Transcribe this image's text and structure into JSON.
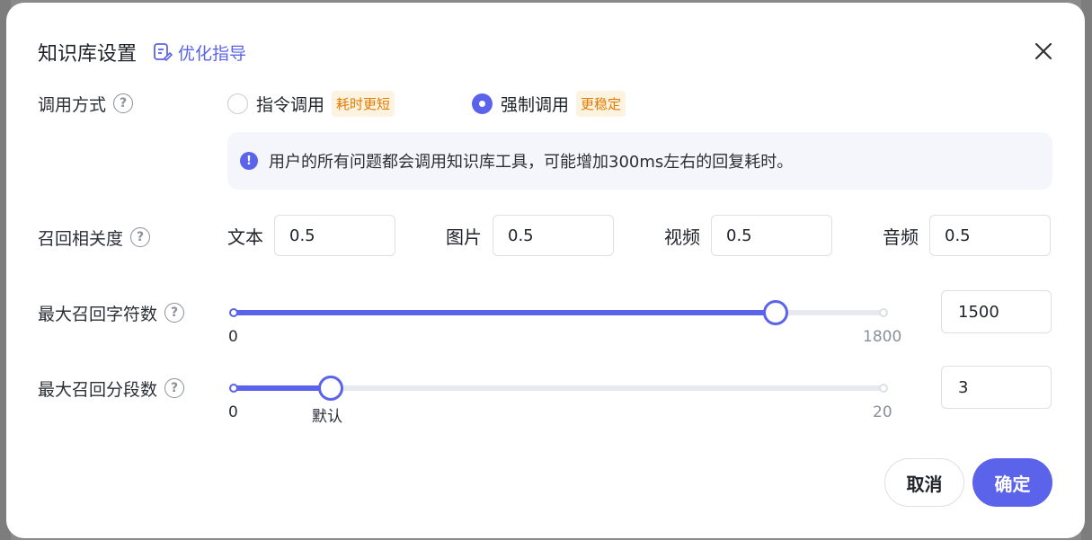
{
  "dialog": {
    "title": "知识库设置",
    "guide_link": "优化指导",
    "close_icon": "close-icon"
  },
  "invoke": {
    "label": "调用方式",
    "options": [
      {
        "label": "指令调用",
        "tag": "耗时更短",
        "checked": false
      },
      {
        "label": "强制调用",
        "tag": "更稳定",
        "checked": true
      }
    ],
    "info": "用户的所有问题都会调用知识库工具，可能增加300ms左右的回复耗时。"
  },
  "relevance": {
    "label": "召回相关度",
    "items": [
      {
        "label": "文本",
        "value": "0.5"
      },
      {
        "label": "图片",
        "value": "0.5"
      },
      {
        "label": "视频",
        "value": "0.5"
      },
      {
        "label": "音频",
        "value": "0.5"
      }
    ]
  },
  "max_chars": {
    "label": "最大召回字符数",
    "min": 0,
    "max": 1800,
    "value": 1500,
    "min_label": "0",
    "max_label": "1800",
    "input_value": "1500"
  },
  "max_segments": {
    "label": "最大召回分段数",
    "min": 0,
    "max": 20,
    "value": 3,
    "min_label": "0",
    "max_label": "20",
    "default_label": "默认",
    "input_value": "3"
  },
  "footer": {
    "cancel_label": "取消",
    "ok_label": "确定"
  },
  "colors": {
    "accent": "#5a63e9",
    "tag_bg": "#fef3e1",
    "tag_text": "#e07b00"
  }
}
